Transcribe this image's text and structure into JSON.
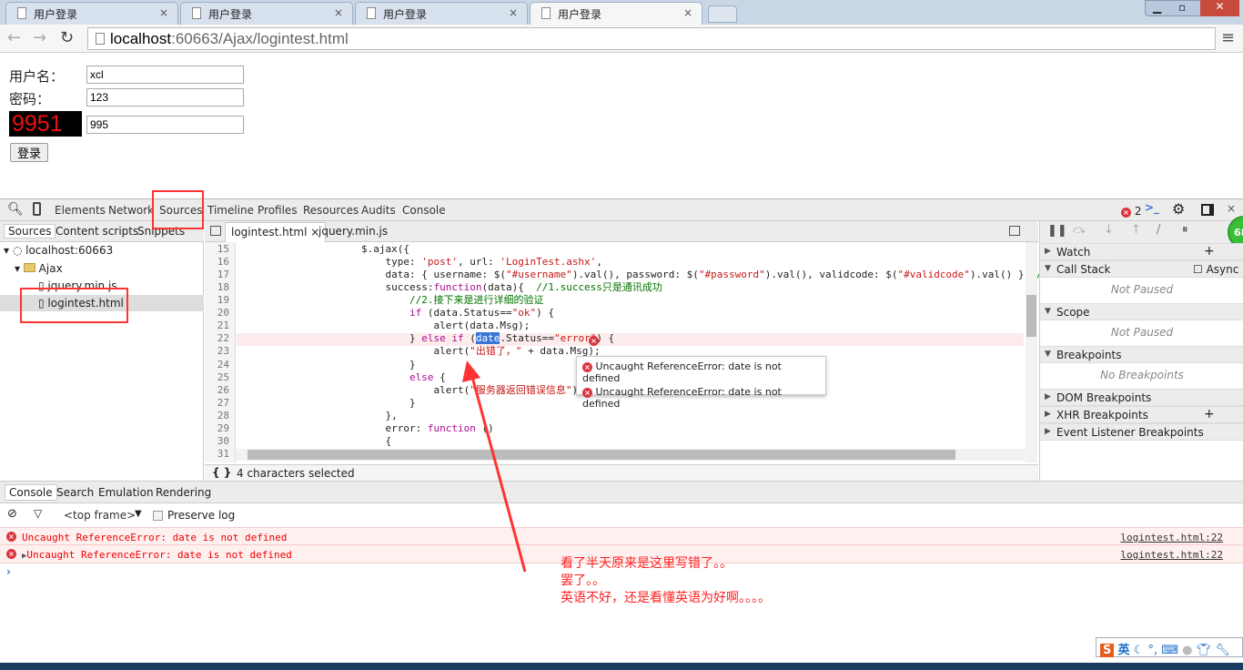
{
  "browser": {
    "tabs": [
      {
        "title": "用户登录"
      },
      {
        "title": "用户登录"
      },
      {
        "title": "用户登录"
      },
      {
        "title": "用户登录",
        "active": true
      }
    ],
    "url_host": "localhost",
    "url_rest": ":60663/Ajax/logintest.html"
  },
  "page": {
    "username_label": "用户名：",
    "username_value": "xcl",
    "password_label": "密码：",
    "password_value": "123",
    "captcha_image_text": "9951",
    "captcha_value": "995",
    "login_button": "登录"
  },
  "devtools": {
    "tabs": [
      "Elements",
      "Network",
      "Sources",
      "Timeline",
      "Profiles",
      "Resources",
      "Audits",
      "Console"
    ],
    "error_count": "2",
    "navigator": {
      "tabs": [
        "Sources",
        "Content scripts",
        "Snippets"
      ],
      "host": "localhost:60663",
      "folder": "Ajax",
      "files": [
        "jquery.min.js",
        "logintest.html"
      ]
    },
    "editor": {
      "tabs": [
        "logintest.html",
        "jquery.min.js"
      ],
      "status": "4 characters selected",
      "line_numbers": [
        "15",
        "16",
        "17",
        "18",
        "19",
        "20",
        "21",
        "22",
        "23",
        "24",
        "25",
        "26",
        "27",
        "28",
        "29",
        "30",
        "31"
      ],
      "lines": [
        [
          [
            "",
            "$.ajax({"
          ]
        ],
        [
          [
            "",
            "    type: "
          ],
          [
            "str",
            "'post'"
          ],
          [
            "",
            ", url: "
          ],
          [
            "str",
            "'LoginTest.ashx'"
          ],
          [
            "",
            ","
          ]
        ],
        [
          [
            "",
            "    data: { username: $("
          ],
          [
            "str",
            "\"#username\""
          ],
          [
            "",
            ").val(), password: $("
          ],
          [
            "str",
            "\"#password\""
          ],
          [
            "",
            ").val(), validcode: $("
          ],
          [
            "str",
            "\"#validcode\""
          ],
          [
            "",
            ").val() },"
          ],
          [
            "cm",
            "//传"
          ]
        ],
        [
          [
            "",
            "    success:"
          ],
          [
            "kw",
            "function"
          ],
          [
            "",
            "(data){  "
          ],
          [
            "cm",
            "//1.success只是通讯成功"
          ]
        ],
        [
          [
            "cm",
            "        //2.接下来是进行详细的验证"
          ]
        ],
        [
          [
            "kw",
            "        if"
          ],
          [
            "",
            " (data.Status=="
          ],
          [
            "str",
            "\"ok\""
          ],
          [
            "",
            ") {"
          ]
        ],
        [
          [
            "",
            "            alert(data.Msg);"
          ]
        ],
        [
          [
            "",
            "        } "
          ],
          [
            "kw",
            "else if"
          ],
          [
            "",
            " ("
          ],
          [
            "sel",
            "date"
          ],
          [
            "",
            ".Status=="
          ],
          [
            "str",
            "\"error\""
          ],
          [
            "",
            ") {"
          ]
        ],
        [
          [
            "",
            "            alert("
          ],
          [
            "str",
            "\"出错了，\""
          ],
          [
            "",
            " + data.Msg);"
          ]
        ],
        [
          [
            "",
            "        }"
          ]
        ],
        [
          [
            "kw",
            "        else"
          ],
          [
            "",
            " {"
          ]
        ],
        [
          [
            "",
            "            alert("
          ],
          [
            "str",
            "\"服务器返回错误信息\""
          ],
          [
            "",
            ");"
          ]
        ],
        [
          [
            "",
            "        }"
          ]
        ],
        [
          [
            "",
            "    },"
          ]
        ],
        [
          [
            "",
            "    error: "
          ],
          [
            "kw",
            "function"
          ],
          [
            "",
            " ()"
          ]
        ],
        [
          [
            "",
            "    {"
          ]
        ],
        [
          [
            "",
            ""
          ]
        ]
      ],
      "popup_errors": [
        "Uncaught ReferenceError: date is not defined",
        "Uncaught ReferenceError: date is not defined"
      ]
    },
    "debugger": {
      "sections": [
        {
          "label": "Watch",
          "open": false
        },
        {
          "label": "Call Stack",
          "open": true,
          "body": "Not Paused",
          "extra": "Async"
        },
        {
          "label": "Scope",
          "open": true,
          "body": "Not Paused"
        },
        {
          "label": "Breakpoints",
          "open": true,
          "body": "No Breakpoints"
        },
        {
          "label": "DOM Breakpoints",
          "open": false
        },
        {
          "label": "XHR Breakpoints",
          "open": false
        },
        {
          "label": "Event Listener Breakpoints",
          "open": false
        }
      ],
      "badge": "68"
    },
    "console": {
      "tabs": [
        "Console",
        "Search",
        "Emulation",
        "Rendering"
      ],
      "frame": "<top frame>",
      "preserve_log": "Preserve log",
      "messages": [
        {
          "text": "Uncaught ReferenceError: date is not defined",
          "source": "logintest.html:22"
        },
        {
          "text": "Uncaught ReferenceError: date is not defined",
          "source": "logintest.html:22"
        }
      ]
    }
  },
  "annotation": {
    "lines": [
      "看了半天原来是这里写错了。。",
      "罢了。。",
      "英语不好，还是看懂英语为好啊。。。。"
    ],
    "color": "#ff2222"
  },
  "ime": {
    "lang": "英"
  }
}
